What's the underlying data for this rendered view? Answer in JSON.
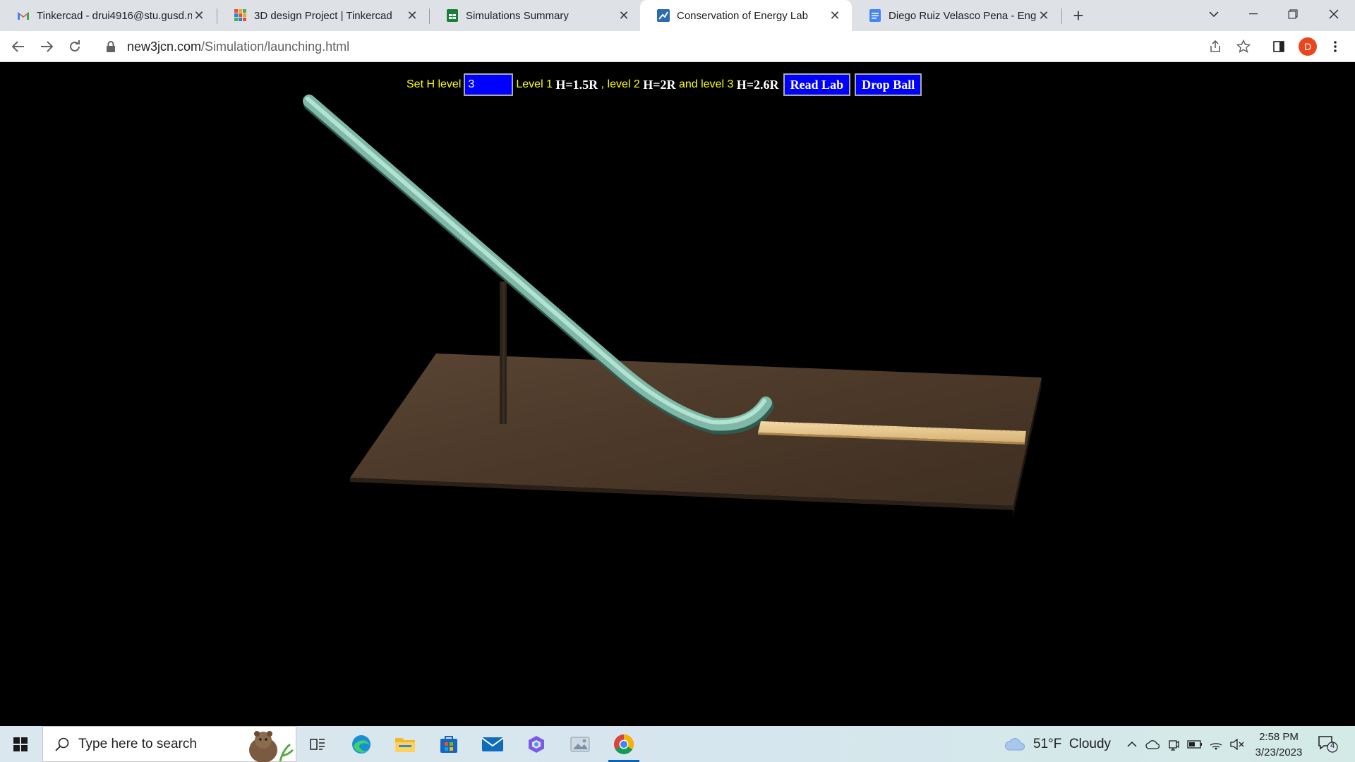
{
  "browser": {
    "tabs": [
      {
        "title": "Tinkercad - drui4916@stu.gusd.n",
        "icon": "gmail-icon"
      },
      {
        "title": "3D design Project | Tinkercad",
        "icon": "tinkercad-icon"
      },
      {
        "title": "Simulations Summary",
        "icon": "sheets-icon"
      },
      {
        "title": "Conservation of Energy Lab",
        "icon": "simulation-icon",
        "active": true
      },
      {
        "title": "Diego Ruiz Velasco Pena - Engine",
        "icon": "docs-icon"
      }
    ],
    "url_host": "new3jcn.com",
    "url_path": "/Simulation/launching.html",
    "profile_initial": "D"
  },
  "simulation": {
    "set_h_label": "Set H level",
    "h_level_value": "3",
    "level1_label": "Level 1",
    "level1_formula": "H=1.5R",
    "level2_label": ", level 2",
    "level2_formula": "H=2R",
    "level3_label": "and level 3",
    "level3_formula": "H=2.6R",
    "read_lab_button": "Read Lab",
    "drop_ball_button": "Drop Ball"
  },
  "taskbar": {
    "search_placeholder": "Type here to search",
    "weather_temp": "51°F",
    "weather_desc": "Cloudy",
    "time": "2:58 PM",
    "date": "3/23/2023",
    "notification_count": "4"
  },
  "colors": {
    "accent_blue": "#0000ff",
    "label_yellow": "#ffff00",
    "table_brown": "#4e3b2a",
    "track_color": "#8fc9b5",
    "ruler_color": "#e6c489"
  }
}
